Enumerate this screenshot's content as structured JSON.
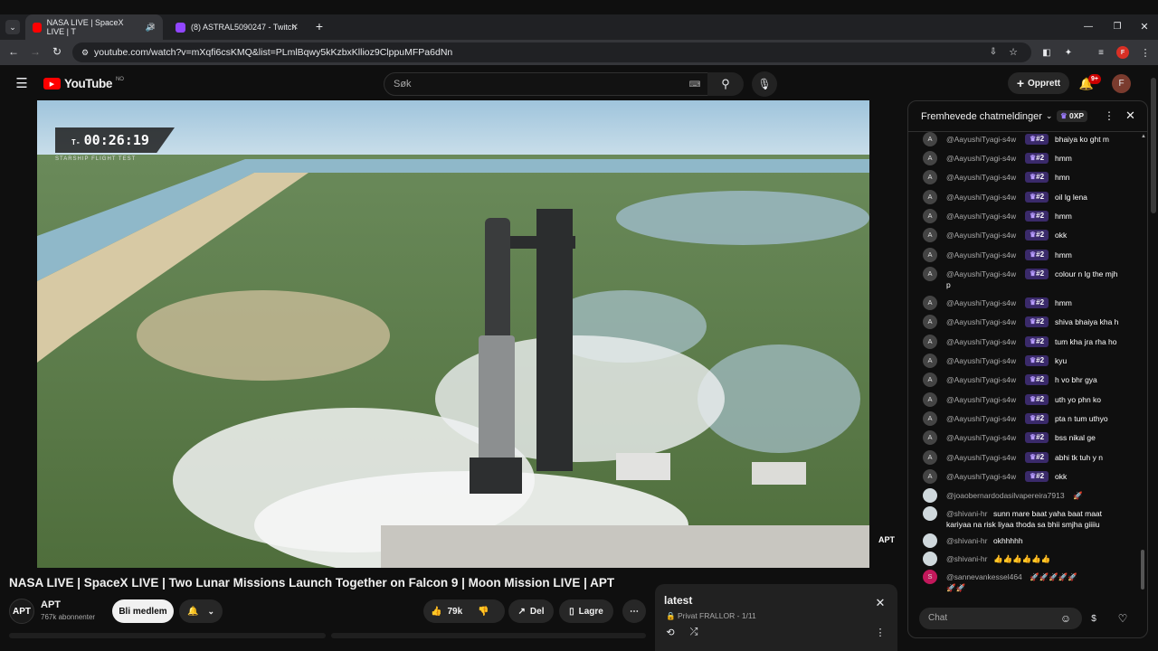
{
  "browser": {
    "tabs": [
      {
        "title": "NASA LIVE | SpaceX LIVE | T",
        "active": true
      },
      {
        "title": "(8) ASTRAL5090247 - Twitch",
        "active": false
      }
    ],
    "url": "youtube.com/watch?v=mXqfi6csKMQ&list=PLmlBqwy5kKzbxKllioz9ClppuMFPa6dNn",
    "new_tab": "+",
    "profile_letter": "F"
  },
  "youtube": {
    "logo_text": "YouTube",
    "region": "NO",
    "search_placeholder": "Søk",
    "create_label": "Opprett",
    "notif_count": "9+",
    "avatar_letter": "F"
  },
  "player": {
    "timer_prefix": "T-",
    "timer": "00:26:19",
    "subtitle": "STARSHIP FLIGHT TEST",
    "watermark": "APT"
  },
  "video": {
    "title": "NASA LIVE | SpaceX LIVE | Two Lunar Missions Launch Together on Falcon 9 | Moon Mission LIVE | APT",
    "channel": "APT",
    "subscribers": "767k abonnenter",
    "join_label": "Bli medlem",
    "likes": "79k",
    "share_label": "Del",
    "save_label": "Lagre"
  },
  "playlist": {
    "title": "latest",
    "meta": "Privat FRALLOR - 1/11"
  },
  "chat": {
    "header": "Fremhevede chatmeldinger",
    "xp_badge": "0XP",
    "input_placeholder": "Chat",
    "messages": [
      {
        "initial": "A",
        "author": "@AayushiTyagi-s4w",
        "badge": "#2",
        "text": "bhaiya ko ght m"
      },
      {
        "initial": "A",
        "author": "@AayushiTyagi-s4w",
        "badge": "#2",
        "text": "hmm"
      },
      {
        "initial": "A",
        "author": "@AayushiTyagi-s4w",
        "badge": "#2",
        "text": "hmn"
      },
      {
        "initial": "A",
        "author": "@AayushiTyagi-s4w",
        "badge": "#2",
        "text": "oil lg lena"
      },
      {
        "initial": "A",
        "author": "@AayushiTyagi-s4w",
        "badge": "#2",
        "text": "hmm"
      },
      {
        "initial": "A",
        "author": "@AayushiTyagi-s4w",
        "badge": "#2",
        "text": "okk"
      },
      {
        "initial": "A",
        "author": "@AayushiTyagi-s4w",
        "badge": "#2",
        "text": "hmm"
      },
      {
        "initial": "A",
        "author": "@AayushiTyagi-s4w",
        "badge": "#2",
        "text": "colour n lg the mjh",
        "text2": "p"
      },
      {
        "initial": "A",
        "author": "@AayushiTyagi-s4w",
        "badge": "#2",
        "text": "hmm"
      },
      {
        "initial": "A",
        "author": "@AayushiTyagi-s4w",
        "badge": "#2",
        "text": "shiva bhaiya kha h"
      },
      {
        "initial": "A",
        "author": "@AayushiTyagi-s4w",
        "badge": "#2",
        "text": "tum kha jra rha ho"
      },
      {
        "initial": "A",
        "author": "@AayushiTyagi-s4w",
        "badge": "#2",
        "text": "kyu"
      },
      {
        "initial": "A",
        "author": "@AayushiTyagi-s4w",
        "badge": "#2",
        "text": "h vo bhr gya"
      },
      {
        "initial": "A",
        "author": "@AayushiTyagi-s4w",
        "badge": "#2",
        "text": "uth yo phn ko"
      },
      {
        "initial": "A",
        "author": "@AayushiTyagi-s4w",
        "badge": "#2",
        "text": "pta n tum uthyo"
      },
      {
        "initial": "A",
        "author": "@AayushiTyagi-s4w",
        "badge": "#2",
        "text": "bss nikal ge"
      },
      {
        "initial": "A",
        "author": "@AayushiTyagi-s4w",
        "badge": "#2",
        "text": "abhi tk tuh y n"
      },
      {
        "initial": "A",
        "author": "@AayushiTyagi-s4w",
        "badge": "#2",
        "text": "okk"
      }
    ],
    "extra": [
      {
        "author": "@joaobernardodasilvapereira7913",
        "text": "🚀"
      },
      {
        "author": "@shivani-hr",
        "text": "sunn mare baat yaha baat maat",
        "text2": "kariyaa na risk liyaa thoda sa bhii smjha giiiiu"
      },
      {
        "author": "@shivani-hr",
        "text": "okhhhhh"
      },
      {
        "author": "@shivani-hr",
        "text": "👍👍👍👍👍👍"
      },
      {
        "author": "@sannevankessel464",
        "initial": "S",
        "text": "🚀🚀🚀🚀🚀",
        "text2": "🚀🚀"
      }
    ]
  },
  "colors": {
    "accent": "#ff0000",
    "badge": "#3a2a6a",
    "sannen_avatar": "#c2185b"
  }
}
